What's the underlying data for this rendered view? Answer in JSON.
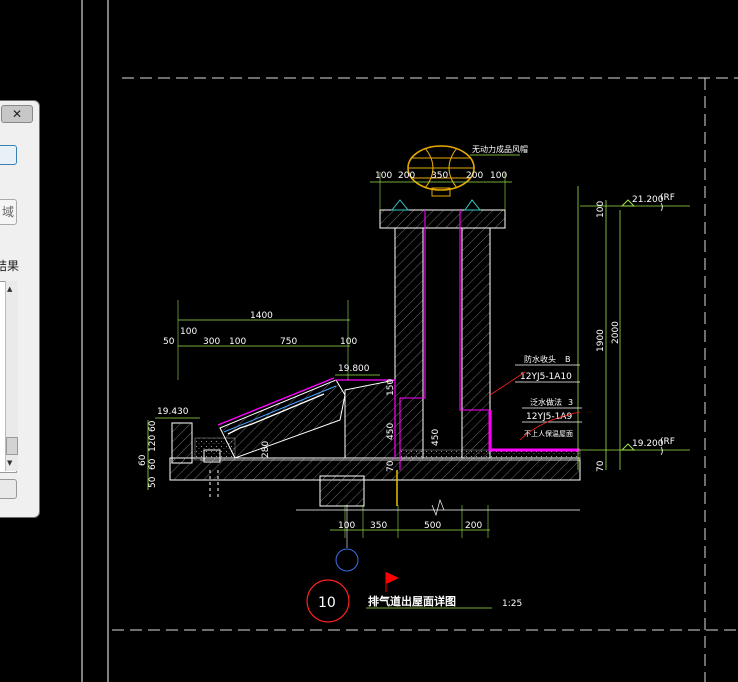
{
  "drawing": {
    "top_dims": [
      "100",
      "200",
      "350",
      "200",
      "100"
    ],
    "fan_label": "无动力成品风帽",
    "left_dims": [
      "50",
      "100",
      "300",
      "100",
      "750",
      "100"
    ],
    "left_total": "1400",
    "elev_top": "21.200",
    "elev_bottom": "19.200",
    "elev_rf_top": "(RF",
    "elev_rf_top2": ")",
    "elev_rf_bottom": "(RF",
    "elev_rf_bottom2": ")",
    "elev_mid": "19.800",
    "elev_left": "19.430",
    "right_dims": [
      "100",
      "1900",
      "2000"
    ],
    "shaft_dims": [
      "150",
      "450",
      "450",
      "70",
      "280",
      "70"
    ],
    "left_stack_dims": [
      "60",
      "120",
      "60",
      "60",
      "50",
      "60"
    ],
    "bottom_dims": [
      "100",
      "350",
      "500",
      "200"
    ],
    "note1_title": "防水收头",
    "note1_ref": "B",
    "note1_code": "12YJ5-1A10",
    "note2_title": "泛水做法",
    "note2_ref": "3",
    "note2_code": "12YJ5-1A9",
    "note3": "不上人保温屋面",
    "detail_number": "10",
    "detail_title": "排气道出屋面详图",
    "detail_scale": "1:25"
  },
  "dialog": {
    "close_label": "✕",
    "region_label": "域",
    "result_label": "结果",
    "scroll_up": "▲",
    "scroll_down": "▼"
  },
  "colors": {
    "background": "#000000",
    "dim_green": "#9be34c",
    "outline_white": "#ffffff",
    "waterproof_magenta": "#ff00ff",
    "hatch_gray": "#9a9a9a",
    "annotation_red": "#ff2020",
    "grid_blue": "#3a6ee8",
    "bar_yellow": "#e6c200"
  }
}
